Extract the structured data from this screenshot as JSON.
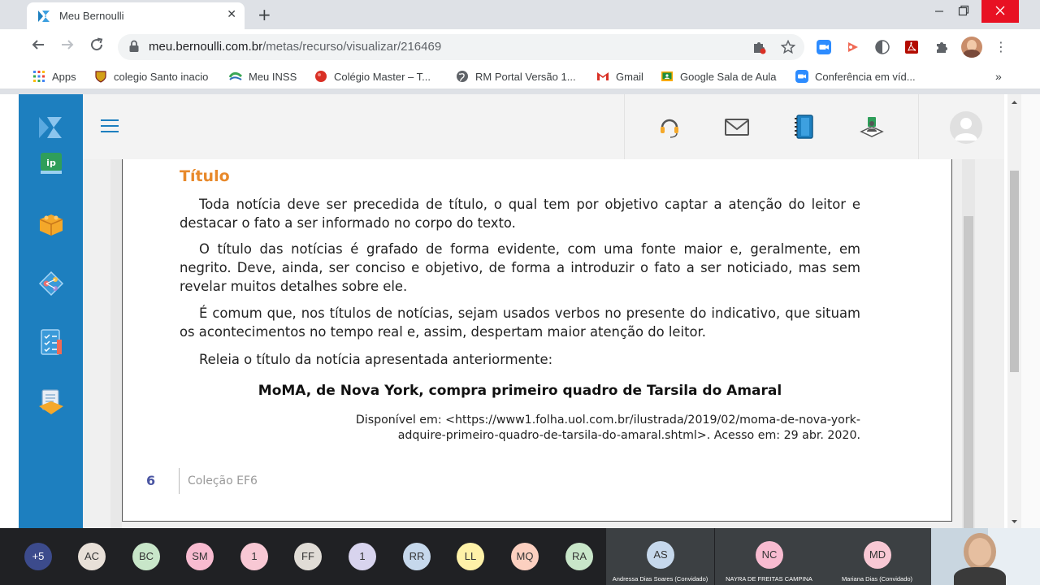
{
  "browser": {
    "tab_title": "Meu Bernoulli",
    "new_tab_symbol": "+",
    "close_symbol": "✕",
    "url_host": "meu.bernoulli.com.br",
    "url_path": "/metas/recurso/visualizar/216469",
    "bookmarks": [
      {
        "label": "Apps",
        "color": "#4285f4"
      },
      {
        "label": "colegio Santo inacio",
        "color": "#d4a017"
      },
      {
        "label": "Meu INSS",
        "color": "#3aa655"
      },
      {
        "label": "Colégio Master – T...",
        "color": "#d93025"
      },
      {
        "label": "RM Portal Versão 1...",
        "color": "#5f6368"
      },
      {
        "label": "Gmail",
        "color": "#d93025"
      },
      {
        "label": "Google Sala de Aula",
        "color": "#f9ab00"
      },
      {
        "label": "Conferência em víd...",
        "color": "#2d8cff"
      }
    ],
    "bookmarks_overflow": "»"
  },
  "document": {
    "heading": "Título",
    "paragraphs": [
      "Toda notícia deve ser precedida de título, o qual tem por objetivo captar a atenção do leitor e destacar o fato a ser informado no corpo do texto.",
      "O título das notícias é grafado de forma evidente, com uma fonte maior e, geralmente, em negrito. Deve, ainda, ser conciso e objetivo, de forma a introduzir o fato a ser noticiado, mas sem revelar muitos detalhes sobre ele.",
      "É comum que, nos títulos de notícias, sejam usados verbos no presente do indicativo, que situam os acontecimentos no tempo real e, assim, despertam maior atenção do leitor.",
      "Releia o título da notícia apresentada anteriormente:"
    ],
    "headline": "MoMA, de Nova York, compra primeiro quadro de Tarsila do Amaral",
    "source_line1": "Disponível em: <https://www1.folha.uol.com.br/ilustrada/2019/02/moma-de-nova-york-",
    "source_line2": "adquire-primeiro-quadro-de-tarsila-do-amaral.shtml>. Acesso em: 29 abr. 2020.",
    "page_number": "6",
    "collection": "Coleção EF6"
  },
  "meet": {
    "participants": [
      {
        "initials": "+5",
        "color": "#3c4b8c",
        "text": "#ffffff"
      },
      {
        "initials": "AC",
        "color": "#e8e0d8",
        "text": "#333333"
      },
      {
        "initials": "BC",
        "color": "#c8e6c9",
        "text": "#333333"
      },
      {
        "initials": "SM",
        "color": "#f8bbd0",
        "text": "#333333"
      },
      {
        "initials": "1",
        "color": "#f8c8d4",
        "text": "#333333"
      },
      {
        "initials": "FF",
        "color": "#e0dcd6",
        "text": "#333333"
      },
      {
        "initials": "1",
        "color": "#d8d4ee",
        "text": "#333333"
      },
      {
        "initials": "RR",
        "color": "#c6d8ec",
        "text": "#333333"
      },
      {
        "initials": "LL",
        "color": "#fff2a8",
        "text": "#333333"
      },
      {
        "initials": "MQ",
        "color": "#fcd0c0",
        "text": "#333333"
      },
      {
        "initials": "RA",
        "color": "#c8e6c9",
        "text": "#333333"
      }
    ],
    "tiles": [
      {
        "initials": "AS",
        "color": "#c6d8ec",
        "name": "Andressa Dias Soares (Convidado)"
      },
      {
        "initials": "NC",
        "color": "#f8bbd0",
        "name": "NAYRA DE FREITAS CAMPINA"
      },
      {
        "initials": "MD",
        "color": "#f8c8d4",
        "name": "Mariana Dias (Convidado)"
      }
    ]
  }
}
